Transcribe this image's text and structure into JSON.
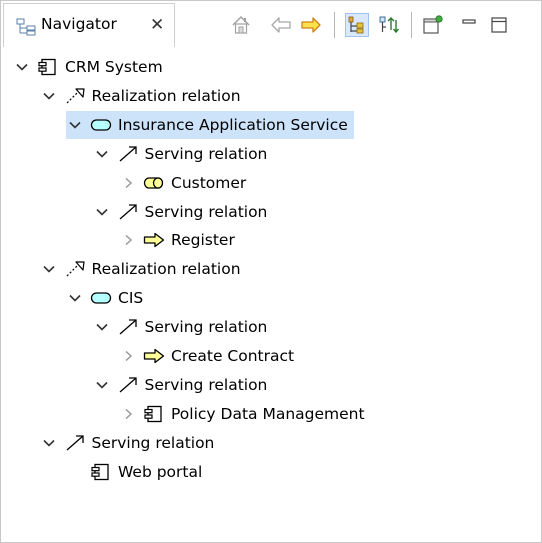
{
  "view": {
    "tab_label": "Navigator",
    "tab_close": "✕",
    "toolbar": [
      {
        "name": "home-button",
        "icon": "home-icon"
      },
      {
        "name": "back-button",
        "icon": "arrow-left-icon"
      },
      {
        "name": "forward-button",
        "icon": "arrow-right-icon"
      },
      {
        "name": "link-to-selection-button",
        "icon": "link-tree-icon",
        "selected": true
      },
      {
        "name": "show-children-button",
        "icon": "tree-children-icon"
      },
      {
        "name": "open-view-button",
        "icon": "open-view-icon"
      },
      {
        "name": "minimize-button",
        "icon": "minimize-icon"
      },
      {
        "name": "maximize-button",
        "icon": "maximize-icon"
      }
    ]
  },
  "tree": [
    {
      "label": "CRM System",
      "icon": "application-component-icon",
      "twisty": "expanded",
      "depth": 0
    },
    {
      "label": "Realization relation",
      "icon": "realization-relation-icon",
      "twisty": "expanded",
      "depth": 1
    },
    {
      "label": "Insurance Application Service",
      "icon": "application-service-icon",
      "twisty": "expanded",
      "depth": 2,
      "selected": true
    },
    {
      "label": "Serving relation",
      "icon": "serving-relation-icon",
      "twisty": "expanded",
      "depth": 3
    },
    {
      "label": "Customer",
      "icon": "business-role-icon",
      "twisty": "collapsed",
      "depth": 4
    },
    {
      "label": "Serving relation",
      "icon": "serving-relation-icon",
      "twisty": "expanded",
      "depth": 3
    },
    {
      "label": "Register",
      "icon": "business-process-icon",
      "twisty": "collapsed",
      "depth": 4
    },
    {
      "label": "Realization relation",
      "icon": "realization-relation-icon",
      "twisty": "expanded",
      "depth": 1
    },
    {
      "label": "CIS",
      "icon": "application-service-icon",
      "twisty": "expanded",
      "depth": 2
    },
    {
      "label": "Serving relation",
      "icon": "serving-relation-icon",
      "twisty": "expanded",
      "depth": 3
    },
    {
      "label": "Create Contract",
      "icon": "business-process-icon",
      "twisty": "collapsed",
      "depth": 4
    },
    {
      "label": "Serving relation",
      "icon": "serving-relation-icon",
      "twisty": "expanded",
      "depth": 3
    },
    {
      "label": "Policy Data Management",
      "icon": "application-component-icon",
      "twisty": "collapsed",
      "depth": 4
    },
    {
      "label": "Serving relation",
      "icon": "serving-relation-icon",
      "twisty": "expanded",
      "depth": 1
    },
    {
      "label": "Web portal",
      "icon": "application-component-icon",
      "twisty": "none",
      "depth": 2
    }
  ],
  "colors": {
    "selection": "#cde3fa",
    "application_fill": "#b5ffff",
    "business_fill": "#ffff97",
    "icon_stroke": "#000000"
  }
}
